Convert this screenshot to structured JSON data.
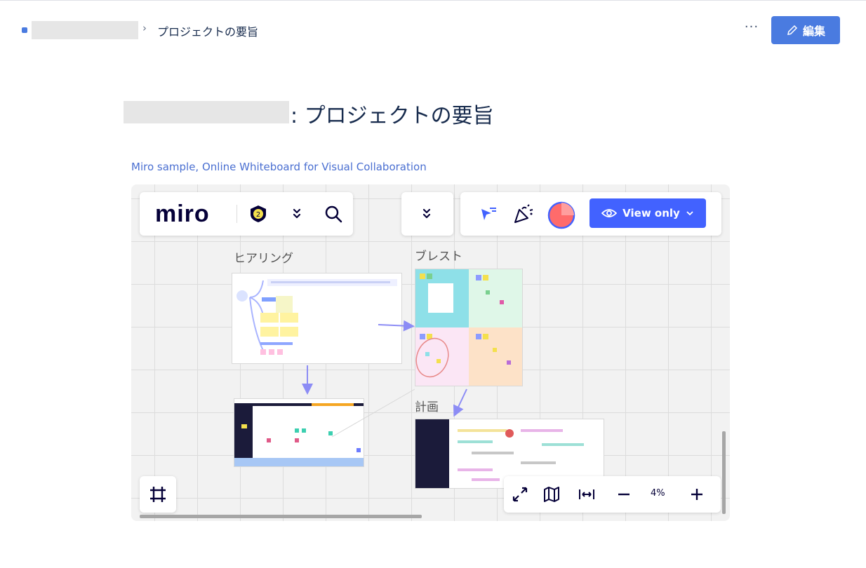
{
  "breadcrumb": {
    "separator": "›",
    "current_page": "プロジェクトの要旨"
  },
  "header": {
    "more_label": "···",
    "edit_label": "編集"
  },
  "page": {
    "title": ": プロジェクトの要旨"
  },
  "embed": {
    "link_text": "Miro sample, Online Whiteboard for Visual Collaboration"
  },
  "miro": {
    "logo_text": "miro",
    "badge_count": "2",
    "view_only_label": "View only",
    "zoom_level": "4%",
    "frames": {
      "hearing": "ヒアリング",
      "brainstorm": "ブレスト",
      "plan": "計画"
    }
  },
  "colors": {
    "edit_button": "#4a7be0",
    "view_only_button": "#4262ff",
    "link": "#4a6fd1",
    "arrow": "#8c8cf5"
  }
}
